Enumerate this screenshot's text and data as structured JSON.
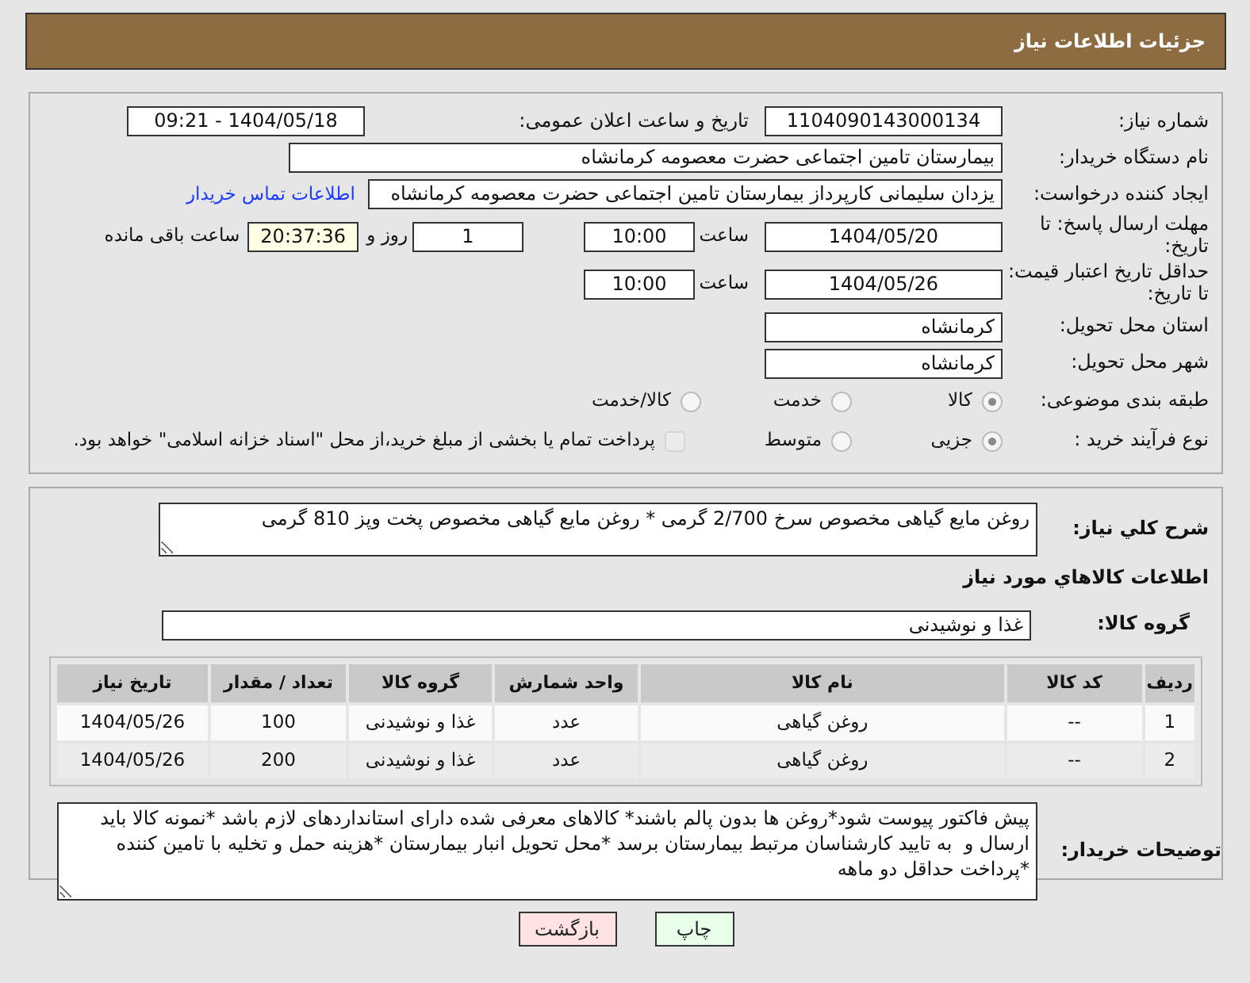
{
  "header": {
    "title": "جزئیات اطلاعات نیاز"
  },
  "need_number": {
    "label": "شماره نیاز:",
    "value": "1104090143000134"
  },
  "announce": {
    "label": "تاریخ و ساعت اعلان عمومی:",
    "value": "1404/05/18 - 09:21"
  },
  "buyer": {
    "label": "نام دستگاه خریدار:",
    "value": "بیمارستان تامین اجتماعی حضرت معصومه کرمانشاه"
  },
  "requester": {
    "label": "ایجاد کننده درخواست:",
    "value": "یزدان  سلیمانی کارپرداز بیمارستان تامین اجتماعی حضرت معصومه کرمانشاه",
    "link": "اطلاعات تماس خریدار"
  },
  "deadline": {
    "label": "مهلت ارسال پاسخ: تا تاریخ:",
    "date": "1404/05/20",
    "time_label": "ساعت",
    "time": "10:00",
    "days": "1",
    "days_label": "روز و",
    "remaining": "20:37:36",
    "remaining_label": "ساعت باقی مانده"
  },
  "validity": {
    "label": "حداقل تاریخ اعتبار قیمت: تا تاریخ:",
    "date": "1404/05/26",
    "time_label": "ساعت",
    "time": "10:00"
  },
  "province": {
    "label": "استان محل تحویل:",
    "value": "کرمانشاه"
  },
  "city": {
    "label": "شهر محل تحویل:",
    "value": "کرمانشاه"
  },
  "category": {
    "label": "طبقه بندی موضوعی:",
    "options": [
      {
        "label": "کالا",
        "selected": true
      },
      {
        "label": "خدمت",
        "selected": false
      },
      {
        "label": "کالا/خدمت",
        "selected": false
      }
    ]
  },
  "process": {
    "label": "نوع فرآیند خرید :",
    "options": [
      {
        "label": "جزیی",
        "selected": true
      },
      {
        "label": "متوسط",
        "selected": false
      }
    ],
    "payment": {
      "label": "پرداخت تمام یا بخشی از مبلغ خرید،از محل \"اسناد خزانه اسلامی\" خواهد بود.",
      "checked": false
    }
  },
  "summary": {
    "label": "شرح كلي نياز:",
    "value": "روغن مایع گیاهی مخصوص سرخ 2/700 گرمی * روغن مایع گیاهی مخصوص پخت وپز 810 گرمی"
  },
  "goods_heading": "اطلاعات كالاهاي مورد نياز",
  "goods_group": {
    "label": "گروه کالا:",
    "value": "غذا و نوشیدنی"
  },
  "table": {
    "columns": [
      "ردیف",
      "کد کالا",
      "نام کالا",
      "واحد شمارش",
      "گروه کالا",
      "تعداد / مقدار",
      "تاریخ نیاز"
    ],
    "rows": [
      [
        "1",
        "--",
        "روغن گیاهی",
        "عدد",
        "غذا و نوشیدنی",
        "100",
        "1404/05/26"
      ],
      [
        "2",
        "--",
        "روغن گیاهی",
        "عدد",
        "غذا و نوشیدنی",
        "200",
        "1404/05/26"
      ]
    ]
  },
  "notes": {
    "label": "توضیحات خریدار:",
    "value": "پیش فاکتور پیوست شود*روغن ها بدون پالم باشند* کالاهای معرفی شده دارای استانداردهای لازم باشد *نمونه کالا باید ارسال و  به تایید کارشناسان مرتبط بیمارستان برسد *محل تحویل انبار بیمارستان *هزینه حمل و تخلیه با تامین کننده *پرداخت حداقل دو ماهه"
  },
  "buttons": [
    {
      "label": "چاپ",
      "kind": "print"
    },
    {
      "label": "بازگشت",
      "kind": "back"
    }
  ]
}
